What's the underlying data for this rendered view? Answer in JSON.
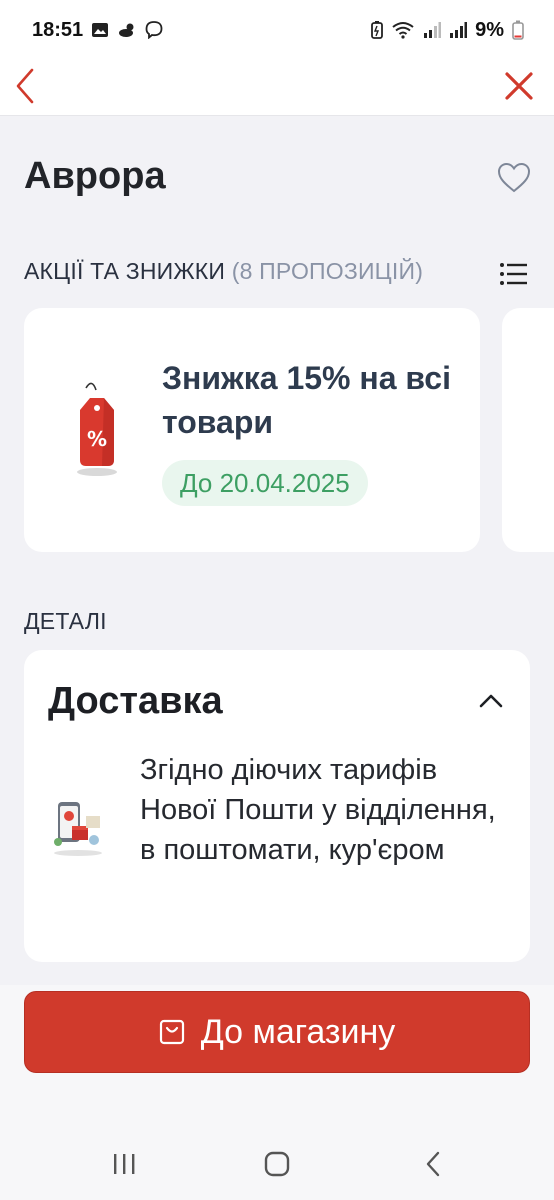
{
  "status_bar": {
    "time": "18:51",
    "battery": "9%",
    "icons_left": [
      "gallery-icon",
      "weather-icon",
      "viber-icon"
    ],
    "icons_right": [
      "battery-saver-icon",
      "wifi-icon",
      "signal-icon",
      "signal-icon-2",
      "battery-icon"
    ]
  },
  "header": {
    "back_icon": "chevron-left-icon",
    "close_icon": "close-icon",
    "accent_color": "#d03a2c"
  },
  "store": {
    "name": "Аврора",
    "favorite_icon": "heart-outline-icon"
  },
  "promotions": {
    "section_label": "АКЦІЇ ТА ЗНИЖКИ",
    "count_label": "(8 ПРОПОЗИЦІЙ)",
    "list_icon": "list-icon",
    "cards": [
      {
        "icon": "discount-tag-icon",
        "title": "Знижка 15% на всі товари",
        "date_badge": "До 20.04.2025"
      }
    ]
  },
  "details": {
    "section_label": "ДЕТАЛІ",
    "card_title": "Доставка",
    "chevron_icon": "chevron-up-icon",
    "delivery_icon": "delivery-phone-icon",
    "text": "Згідно діючих тарифів Нової Пошти у відділення, в поштомати, кур'єром"
  },
  "cta": {
    "label": "До магазину",
    "icon": "shopping-bag-icon"
  },
  "system_nav": {
    "recents": "recents-icon",
    "home": "home-icon",
    "back": "back-icon"
  }
}
